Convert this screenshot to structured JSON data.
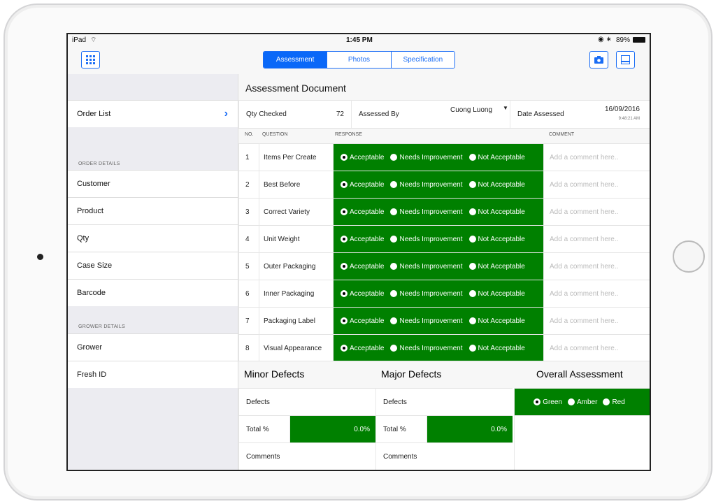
{
  "status": {
    "device": "iPad",
    "time": "1:45 PM",
    "battery": "89%"
  },
  "nav": {
    "tabs": [
      "Assessment",
      "Photos",
      "Specification"
    ],
    "active_tab": "Assessment",
    "accent": "#0a68f8"
  },
  "sidebar": {
    "order_list": "Order List",
    "order_section": "ORDER DETAILS",
    "order_items": [
      "Customer",
      "Product",
      "Qty",
      "Case Size",
      "Barcode"
    ],
    "grower_section": "GROWER DETAILS",
    "grower_items": [
      "Grower",
      "Fresh ID"
    ]
  },
  "doc": {
    "title": "Assessment Document",
    "qty_label": "Qty Checked",
    "qty_value": "72",
    "assessed_label": "Assessed By",
    "assessed_value": "Cuong Luong",
    "date_label": "Date Assessed",
    "date_value": "16/09/2016",
    "time_value": "9:48:21 AM"
  },
  "table": {
    "headers": {
      "no": "NO.",
      "question": "QUESTION",
      "response": "RESPONSE",
      "comment": "COMMENT"
    },
    "options": [
      "Acceptable",
      "Needs Improvement",
      "Not Acceptable"
    ],
    "comment_placeholder": "Add a comment here..",
    "rows": [
      {
        "no": "1",
        "question": "Items Per Create",
        "selected": "Acceptable"
      },
      {
        "no": "2",
        "question": "Best Before",
        "selected": "Acceptable"
      },
      {
        "no": "3",
        "question": "Correct Variety",
        "selected": "Acceptable"
      },
      {
        "no": "4",
        "question": "Unit Weight",
        "selected": "Acceptable"
      },
      {
        "no": "5",
        "question": "Outer Packaging",
        "selected": "Acceptable"
      },
      {
        "no": "6",
        "question": "Inner Packaging",
        "selected": "Acceptable"
      },
      {
        "no": "7",
        "question": "Packaging Label",
        "selected": "Acceptable"
      },
      {
        "no": "8",
        "question": "Visual Appearance",
        "selected": "Acceptable"
      }
    ]
  },
  "defects": {
    "minor": {
      "title": "Minor Defects",
      "defects": "Defects",
      "total": "Total %",
      "total_value": "0.0%",
      "comments": "Comments"
    },
    "major": {
      "title": "Major Defects",
      "defects": "Defects",
      "total": "Total %",
      "total_value": "0.0%",
      "comments": "Comments"
    },
    "overall": {
      "title": "Overall Assessment",
      "options": [
        "Green",
        "Amber",
        "Red"
      ],
      "selected": "Green"
    }
  },
  "colors": {
    "response_green": "#008000"
  }
}
